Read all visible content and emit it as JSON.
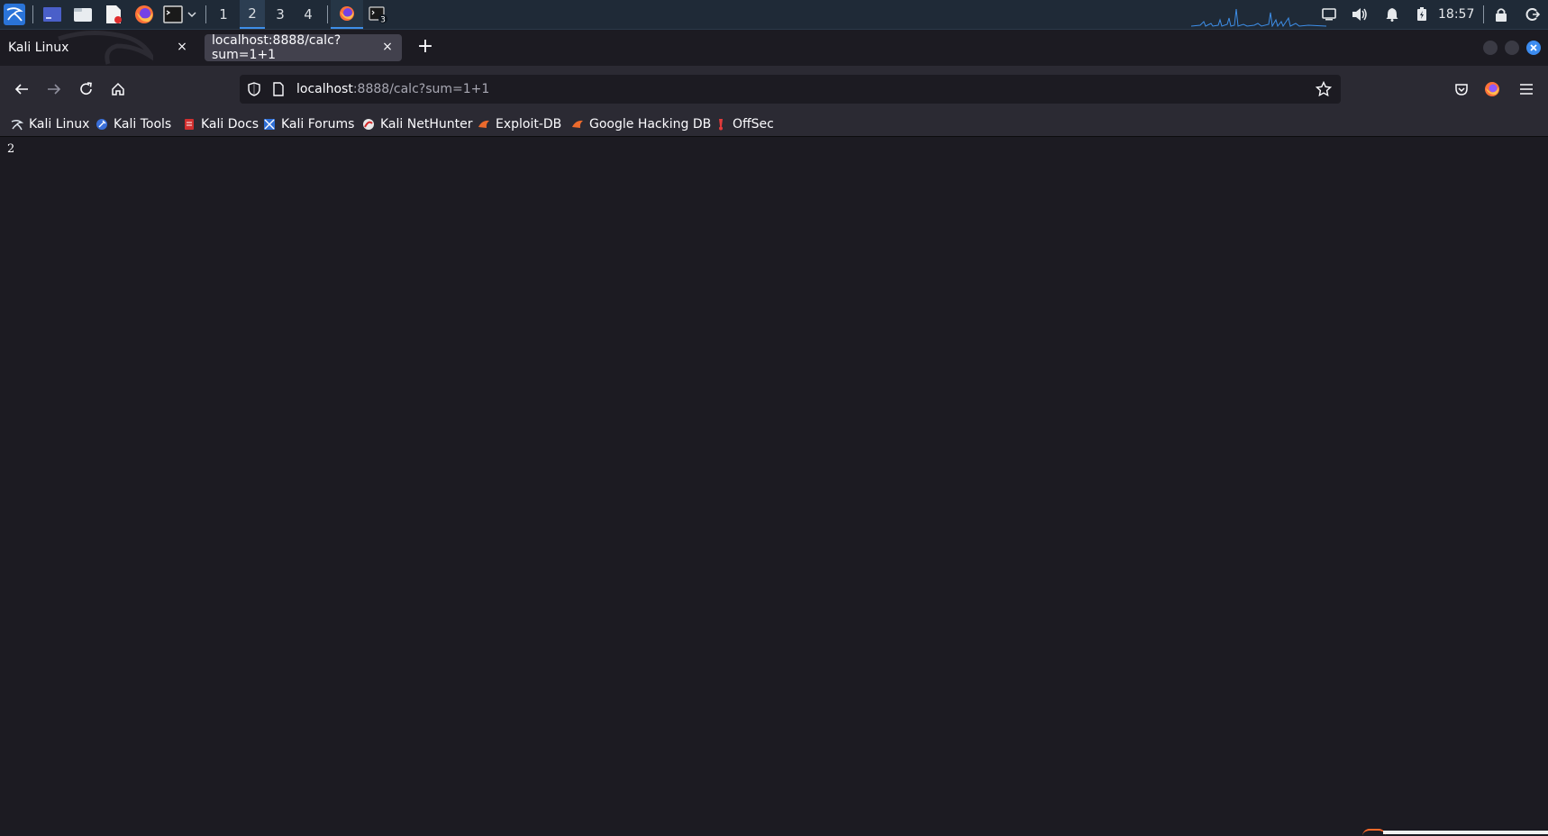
{
  "panel": {
    "workspaces": [
      "1",
      "2",
      "3",
      "4"
    ],
    "active_workspace": "2",
    "terminal_badge": "3",
    "clock": "18:57"
  },
  "browser": {
    "tabs": [
      {
        "title": "Kali Linux",
        "close": "×",
        "active": false
      },
      {
        "title": "localhost:8888/calc?sum=1+1",
        "close": "×",
        "active": true
      }
    ],
    "new_tab": "+",
    "url": {
      "host": "localhost",
      "rest": ":8888/calc?sum=1+1"
    },
    "bookmarks": [
      {
        "label": "Kali Linux",
        "icon": "kali-dragon-icon"
      },
      {
        "label": "Kali Tools",
        "icon": "kali-tools-icon"
      },
      {
        "label": "Kali Docs",
        "icon": "kali-docs-icon"
      },
      {
        "label": "Kali Forums",
        "icon": "kali-forums-icon"
      },
      {
        "label": "Kali NetHunter",
        "icon": "nethunter-icon"
      },
      {
        "label": "Exploit-DB",
        "icon": "exploit-db-icon"
      },
      {
        "label": "Google Hacking DB",
        "icon": "ghdb-icon"
      },
      {
        "label": "OffSec",
        "icon": "offsec-icon"
      }
    ]
  },
  "page": {
    "body_text": "2"
  },
  "colors": {
    "panel_bg": "#1f2a37",
    "accent": "#3d8ee8",
    "browser_bg": "#1c1b22",
    "toolbar_bg": "#2b2a33"
  }
}
